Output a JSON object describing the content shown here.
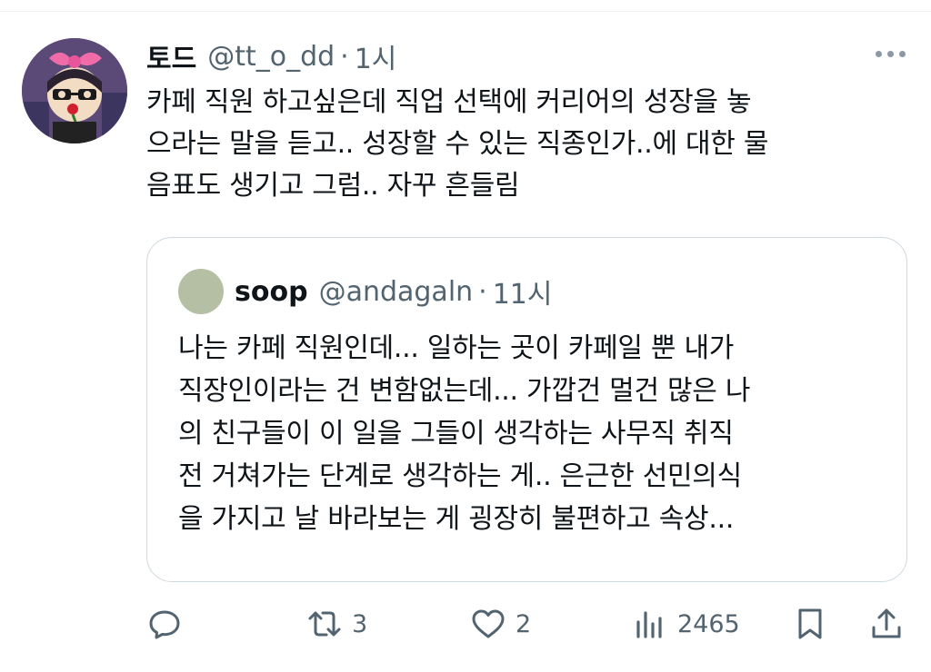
{
  "tweet": {
    "display_name": "토드",
    "handle": "@tt_o_dd",
    "separator": "·",
    "time": "1시",
    "text": "카페 직원 하고싶은데 직업 선택에 커리어의 성장을 놓\n으라는 말을 듣고.. 성장할 수 있는 직종인가..에 대한 물\n음표도 생기고 그럼.. 자꾸 흔들림"
  },
  "quote": {
    "display_name": "soop",
    "handle": "@andagaln",
    "separator": "·",
    "time": "11시",
    "text": "나는 카페 직원인데... 일하는 곳이 카페일 뿐 내가\n직장인이라는 건 변함없는데... 가깝건 멀건 많은 나\n의 친구들이 이 일을 그들이 생각하는 사무직 취직\n전 거쳐가는 단계로 생각하는 게.. 은근한 선민의식\n을 가지고 날 바라보는 게 굉장히 불편하고 속상..."
  },
  "actions": {
    "reply": {
      "icon": "reply-icon"
    },
    "retweet": {
      "icon": "retweet-icon",
      "count": "3"
    },
    "like": {
      "icon": "heart-icon",
      "count": "2"
    },
    "views": {
      "icon": "views-icon",
      "count": "2465"
    },
    "bookmark": {
      "icon": "bookmark-icon"
    },
    "share": {
      "icon": "share-icon"
    }
  },
  "colors": {
    "text": "#0f1419",
    "secondary": "#536471",
    "border": "#cfd9de",
    "quote_avatar": "#b5bfa4"
  }
}
